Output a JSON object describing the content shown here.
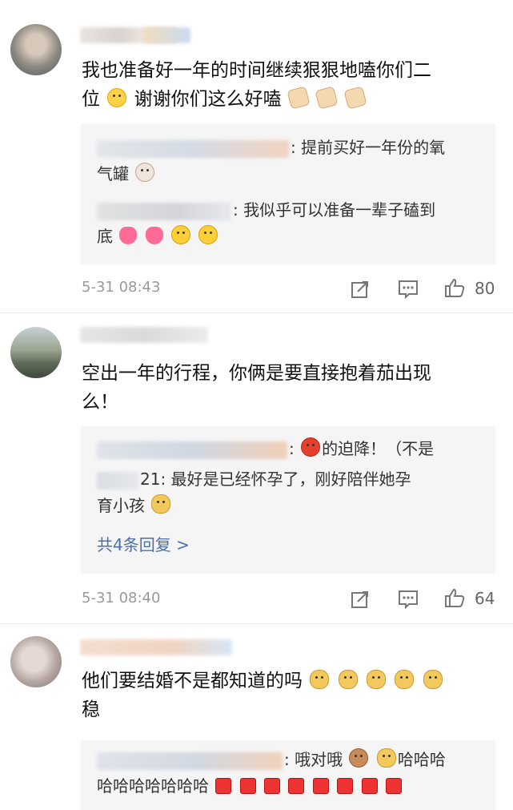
{
  "comments": [
    {
      "text_line1": "我也准备好一年的时间继续狠狠地嗑你们二",
      "text_line2_a": "位",
      "text_line2_b": "谢谢你们这么好嗑",
      "replies": [
        {
          "line1": ": 提前买好一年份的氧",
          "line2": "气罐"
        },
        {
          "line1": ": 我似乎可以准备一辈子磕到",
          "line2": "底"
        }
      ],
      "time": "5-31 08:43",
      "likes": "80"
    },
    {
      "text_line1": "空出一年的行程，你俩是要直接抱着茄出现",
      "text_line2": "么！",
      "replies": [
        {
          "line1_b": "的迫降！（不是"
        },
        {
          "prefix": "21",
          "line1": ": 最好是已经怀孕了，刚好陪伴她孕",
          "line2": "育小孩"
        }
      ],
      "more_replies": "共4条回复 >",
      "time": "5-31 08:40",
      "likes": "64"
    },
    {
      "text_line1": "他们要结婚不是都知道的吗",
      "text_line2": "稳",
      "replies": [
        {
          "line1_a": ": 哦对哦",
          "line1_b": "哈哈哈",
          "line2": "哈哈哈哈哈哈哈"
        }
      ]
    }
  ],
  "icons": {
    "repost": "share-icon",
    "comment": "comment-icon",
    "like": "thumb-up-icon"
  }
}
